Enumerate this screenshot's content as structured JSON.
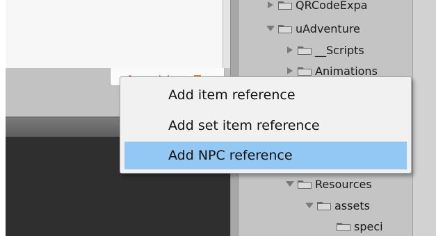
{
  "project_tree": {
    "rows": [
      {
        "label": "QRCodeExpa",
        "expanded": false,
        "indent": 0
      },
      {
        "label": "uAdventure",
        "expanded": true,
        "indent": 0
      },
      {
        "label": "__Scripts",
        "expanded": false,
        "indent": 1
      },
      {
        "label": "Animations",
        "expanded": false,
        "indent": 1
      },
      {
        "label": "Resources",
        "expanded": true,
        "indent": 1
      },
      {
        "label": "assets",
        "expanded": true,
        "indent": 2
      },
      {
        "label": "speci",
        "expanded": null,
        "indent": 3
      }
    ]
  },
  "toolbar": {
    "icons": [
      "person-icon",
      "bow-icon",
      "box-icon"
    ]
  },
  "context_menu": {
    "items": [
      {
        "label": "Add item reference",
        "selected": false
      },
      {
        "label": "Add set item reference",
        "selected": false
      },
      {
        "label": "Add NPC reference",
        "selected": true
      }
    ]
  },
  "colors": {
    "menu_highlight": "#94c8f4",
    "menu_background": "#f1f1f1",
    "tree_background": "#c4c4c4",
    "dark_canvas": "#2f2f2f"
  }
}
